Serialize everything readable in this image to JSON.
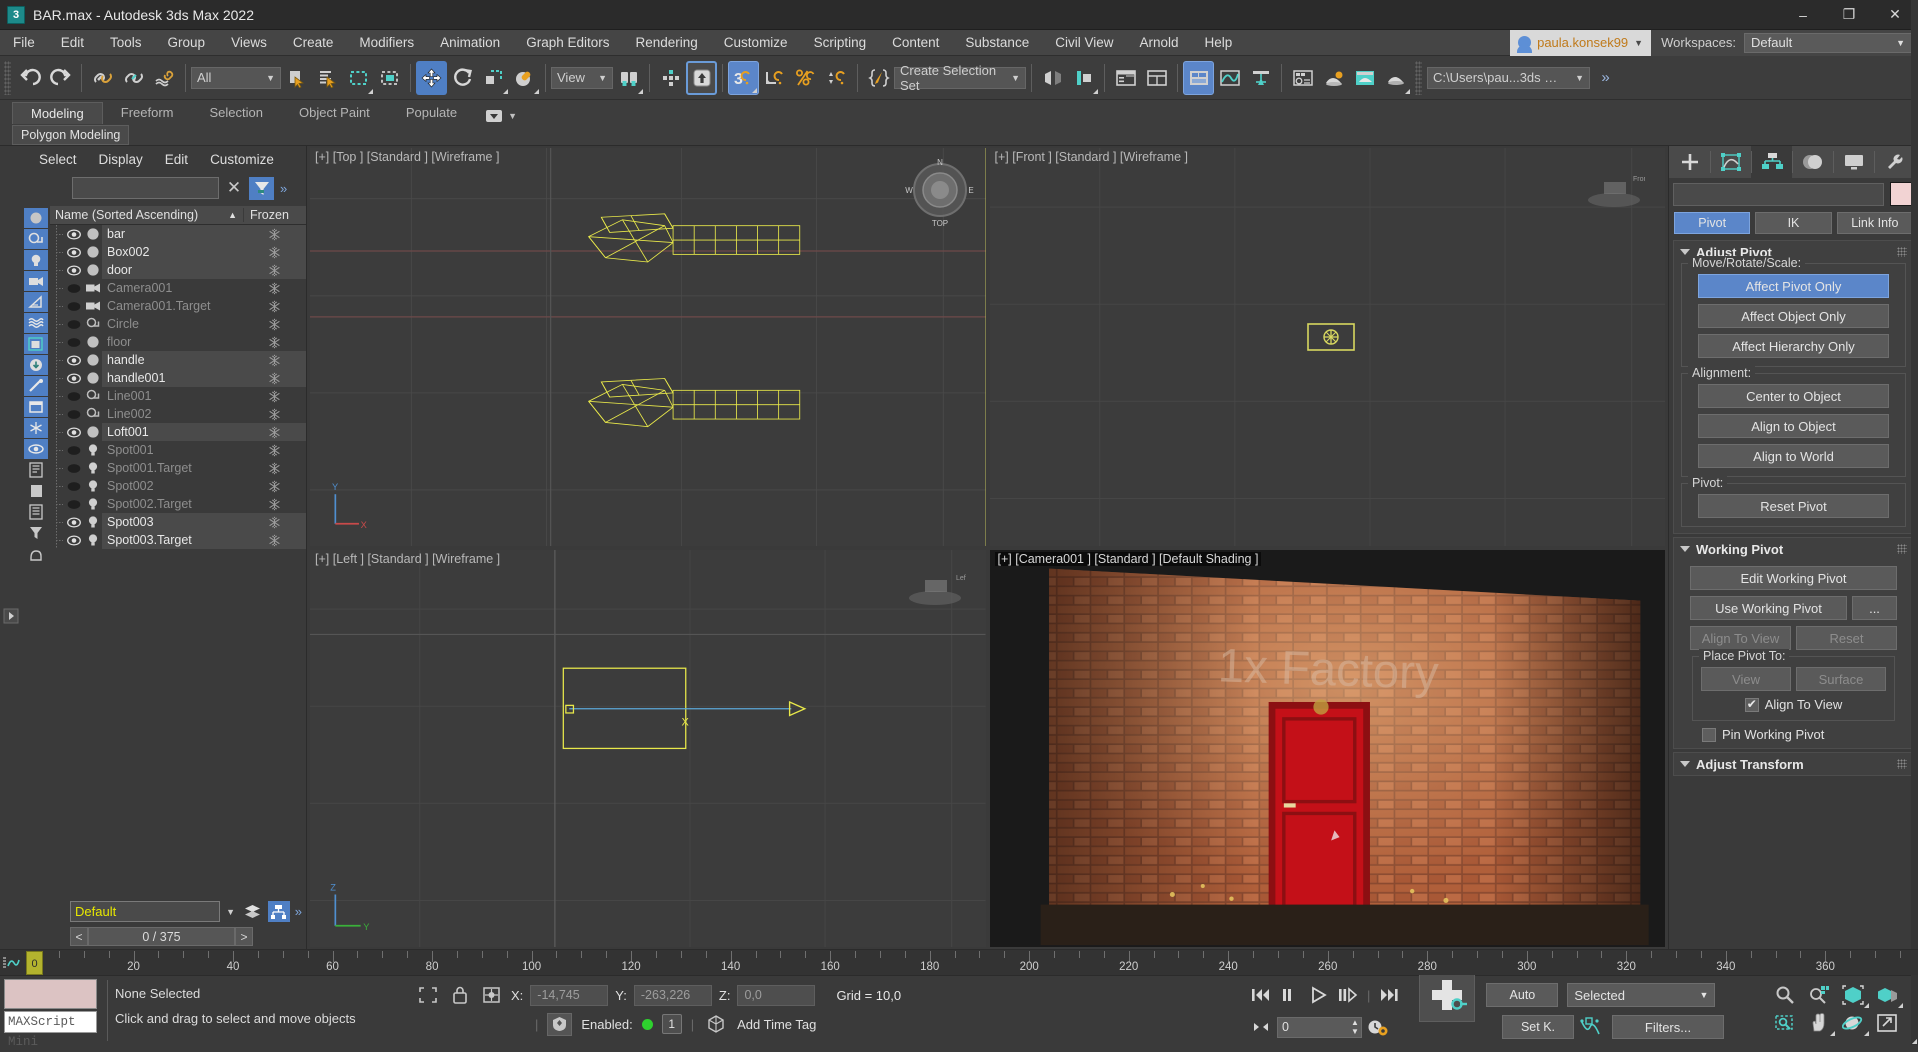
{
  "window": {
    "title": "BAR.max - Autodesk 3ds Max 2022",
    "app_icon": "3ds-max-icon",
    "minimize": "–",
    "maximize": "❐",
    "close": "✕"
  },
  "menubar": {
    "items": [
      "File",
      "Edit",
      "Tools",
      "Group",
      "Views",
      "Create",
      "Modifiers",
      "Animation",
      "Graph Editors",
      "Rendering",
      "Customize",
      "Scripting",
      "Content",
      "Substance",
      "Civil View",
      "Arnold",
      "Help"
    ],
    "user": "paula.konsek99",
    "workspaces_label": "Workspaces:",
    "workspace_value": "Default"
  },
  "toolbar": {
    "selection_filter": "All",
    "view_coord": "View",
    "selection_set": "Create Selection Set",
    "project_path": "C:\\Users\\pau...3ds Max 2022"
  },
  "ribbon": {
    "tabs": [
      "Modeling",
      "Freeform",
      "Selection",
      "Object Paint",
      "Populate"
    ],
    "active_tab": "Modeling",
    "subtab": "Polygon Modeling"
  },
  "explorer": {
    "menu": [
      "Select",
      "Display",
      "Edit",
      "Customize"
    ],
    "search_value": "",
    "search_placeholder": "",
    "columns": [
      "Name (Sorted Ascending)",
      "Frozen"
    ],
    "sort_indicator": "▲",
    "material_field": "Default",
    "frame_counter": "0 / 375",
    "frame_prev": "<",
    "frame_next": ">",
    "items": [
      {
        "name": "bar",
        "type": "geometry",
        "visible": true,
        "dim": false
      },
      {
        "name": "Box002",
        "type": "geometry",
        "visible": true,
        "dim": false
      },
      {
        "name": "door",
        "type": "geometry",
        "visible": true,
        "dim": false
      },
      {
        "name": "Camera001",
        "type": "camera",
        "visible": false,
        "dim": true
      },
      {
        "name": "Camera001.Target",
        "type": "camera",
        "visible": false,
        "dim": true
      },
      {
        "name": "Circle",
        "type": "shape",
        "visible": false,
        "dim": true
      },
      {
        "name": "floor",
        "type": "geometry",
        "visible": false,
        "dim": true
      },
      {
        "name": "handle",
        "type": "geometry",
        "visible": true,
        "dim": false
      },
      {
        "name": "handle001",
        "type": "geometry",
        "visible": true,
        "dim": false
      },
      {
        "name": "Line001",
        "type": "shape",
        "visible": false,
        "dim": true
      },
      {
        "name": "Line002",
        "type": "shape",
        "visible": false,
        "dim": true
      },
      {
        "name": "Loft001",
        "type": "geometry",
        "visible": true,
        "dim": false
      },
      {
        "name": "Spot001",
        "type": "light",
        "visible": false,
        "dim": true
      },
      {
        "name": "Spot001.Target",
        "type": "light",
        "visible": false,
        "dim": true
      },
      {
        "name": "Spot002",
        "type": "light",
        "visible": false,
        "dim": true
      },
      {
        "name": "Spot002.Target",
        "type": "light",
        "visible": false,
        "dim": true
      },
      {
        "name": "Spot003",
        "type": "light",
        "visible": true,
        "dim": false
      },
      {
        "name": "Spot003.Target",
        "type": "light",
        "visible": true,
        "dim": false
      }
    ]
  },
  "viewports": [
    {
      "label": "[+] [Top ] [Standard ] [Wireframe ]",
      "key": "top",
      "active": true
    },
    {
      "label": "[+] [Front ] [Standard ] [Wireframe ]",
      "key": "front",
      "active": false
    },
    {
      "label": "[+] [Left ] [Standard ] [Wireframe ]",
      "key": "left",
      "active": false
    },
    {
      "label": "[+] [Camera001 ] [Standard ] [Default Shading ]",
      "key": "camera",
      "active": false
    }
  ],
  "viewport_overlay": {
    "brick_text": "1x Factory"
  },
  "command_panel": {
    "tabs": [
      "create",
      "modify",
      "hierarchy",
      "motion",
      "display",
      "utilities"
    ],
    "active_tab": "hierarchy",
    "object_name": "",
    "object_color": "#f2d3d3",
    "sub_tabs": [
      "Pivot",
      "IK",
      "Link Info"
    ],
    "active_sub_tab": "Pivot",
    "rollouts": [
      {
        "title": "Adjust Pivot",
        "groups": [
          {
            "label": "Move/Rotate/Scale:",
            "buttons": [
              {
                "label": "Affect Pivot Only",
                "state": "active"
              },
              {
                "label": "Affect Object Only",
                "state": "normal"
              },
              {
                "label": "Affect Hierarchy Only",
                "state": "normal"
              }
            ]
          },
          {
            "label": "Alignment:",
            "buttons": [
              {
                "label": "Center to Object",
                "state": "normal"
              },
              {
                "label": "Align to Object",
                "state": "normal"
              },
              {
                "label": "Align to World",
                "state": "normal"
              }
            ]
          },
          {
            "label": "Pivot:",
            "buttons": [
              {
                "label": "Reset Pivot",
                "state": "normal"
              }
            ]
          }
        ]
      },
      {
        "title": "Working Pivot",
        "buttons_col": [
          {
            "label": "Edit Working Pivot",
            "state": "normal"
          }
        ],
        "row1": [
          {
            "label": "Use Working Pivot",
            "state": "normal"
          },
          {
            "label": "...",
            "state": "normal"
          }
        ],
        "row2": [
          {
            "label": "Align To View",
            "state": "disabled"
          },
          {
            "label": "Reset",
            "state": "disabled"
          }
        ],
        "place_group_label": "Place Pivot To:",
        "place_row": [
          {
            "label": "View",
            "state": "disabled"
          },
          {
            "label": "Surface",
            "state": "disabled"
          }
        ],
        "align_checkbox": {
          "label": "Align To View",
          "checked": true
        },
        "pin_checkbox": {
          "label": "Pin Working Pivot",
          "checked": false
        }
      },
      {
        "title": "Adjust Transform"
      }
    ]
  },
  "timeline": {
    "start": 0,
    "end": 375,
    "current_frame": 0,
    "current_frame_label": "0",
    "tick_labels": [
      0,
      20,
      40,
      60,
      80,
      100,
      120,
      140,
      160,
      180,
      200,
      220,
      240,
      260,
      280,
      300,
      320,
      340,
      360
    ]
  },
  "statusbar": {
    "material_swatch_color": "#dcc3c3",
    "maxscript_label": "MAXScript Mini",
    "selection_status": "None Selected",
    "prompt": "Click and drag to select and move objects",
    "x_label": "X:",
    "x_value": "-14,745",
    "y_label": "Y:",
    "y_value": "-263,226",
    "z_label": "Z:",
    "z_value": "0,0",
    "grid_label": "Grid = 10,0",
    "enabled_label": "Enabled:",
    "enabled_count": "1",
    "add_time_tag": "Add Time Tag",
    "key_spinner_value": "0",
    "auto_key": "Auto",
    "set_key": "Set K.",
    "key_filter_mode": "Selected",
    "filters": "Filters..."
  }
}
